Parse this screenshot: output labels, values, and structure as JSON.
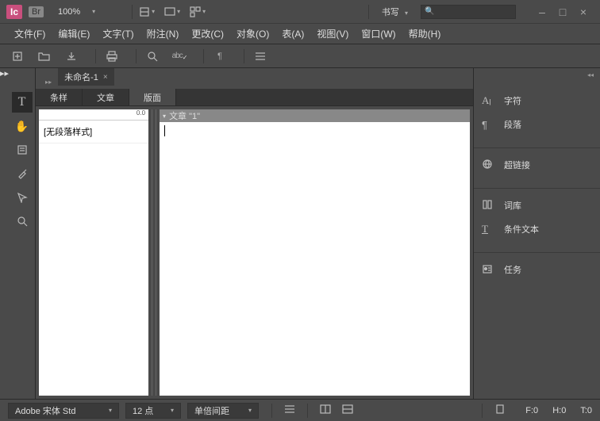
{
  "app": {
    "logo": "Ic",
    "bridge": "Br",
    "zoom": "100%",
    "mode": "书写"
  },
  "window": {
    "minimize": "–",
    "maximize": "□",
    "close": "×"
  },
  "menu": [
    {
      "label": "文件(F)"
    },
    {
      "label": "编辑(E)"
    },
    {
      "label": "文字(T)"
    },
    {
      "label": "附注(N)"
    },
    {
      "label": "更改(C)"
    },
    {
      "label": "对象(O)"
    },
    {
      "label": "表(A)"
    },
    {
      "label": "视图(V)"
    },
    {
      "label": "窗口(W)"
    },
    {
      "label": "帮助(H)"
    }
  ],
  "document": {
    "tab_name": "未命名-1",
    "article_title": "文章 \"1\""
  },
  "view_tabs": [
    {
      "label": "条样",
      "active": false
    },
    {
      "label": "文章",
      "active": false
    },
    {
      "label": "版面",
      "active": true
    }
  ],
  "styles": {
    "ruler_value": "0.0",
    "items": [
      "[无段落样式]"
    ]
  },
  "right_panels": [
    [
      {
        "icon": "A|",
        "label": "字符"
      },
      {
        "icon": "¶",
        "label": "段落"
      }
    ],
    [
      {
        "icon": "link",
        "label": "超链接"
      }
    ],
    [
      {
        "icon": "dict",
        "label": "词库"
      },
      {
        "icon": "T",
        "label": "条件文本"
      }
    ],
    [
      {
        "icon": "task",
        "label": "任务"
      }
    ]
  ],
  "status": {
    "font": "Adobe 宋体 Std",
    "size": "12 点",
    "spacing": "单倍间距",
    "f_stat": "F:0",
    "h_stat": "H:0",
    "t_stat": "T:0"
  },
  "search": {
    "placeholder": "",
    "icon": "🔍"
  }
}
